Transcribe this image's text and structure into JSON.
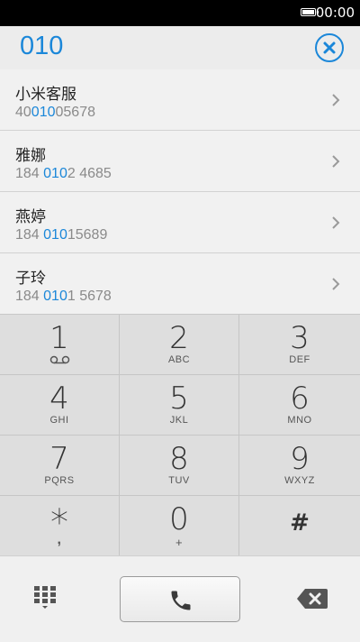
{
  "status_bar": {
    "time": "00:00",
    "battery_icon": "battery-icon"
  },
  "dialer": {
    "input_value": "010",
    "clear_icon": "close-circle-icon"
  },
  "contacts": [
    {
      "name": "小米客服",
      "number": [
        {
          "t": "40"
        },
        {
          "t": "010",
          "hl": true
        },
        {
          "t": "05678"
        }
      ]
    },
    {
      "name": "雅娜",
      "number": [
        {
          "t": "184 "
        },
        {
          "t": "010",
          "hl": true
        },
        {
          "t": "2 4685"
        }
      ]
    },
    {
      "name": "燕婷",
      "number": [
        {
          "t": "184 "
        },
        {
          "t": "010",
          "hl": true
        },
        {
          "t": "15689"
        }
      ]
    },
    {
      "name": "子玲",
      "number": [
        {
          "t": "184 "
        },
        {
          "t": "010",
          "hl": true
        },
        {
          "t": "1 5678"
        }
      ]
    }
  ],
  "keypad": [
    {
      "digit": "1",
      "letters": "",
      "icon": "voicemail-icon"
    },
    {
      "digit": "2",
      "letters": "ABC"
    },
    {
      "digit": "3",
      "letters": "DEF"
    },
    {
      "digit": "4",
      "letters": "GHI"
    },
    {
      "digit": "5",
      "letters": "JKL"
    },
    {
      "digit": "6",
      "letters": "MNO"
    },
    {
      "digit": "7",
      "letters": "PQRS"
    },
    {
      "digit": "8",
      "letters": "TUV"
    },
    {
      "digit": "9",
      "letters": "WXYZ"
    },
    {
      "digit": "*",
      "letters": ","
    },
    {
      "digit": "0",
      "letters": "+"
    },
    {
      "digit": "#",
      "letters": ""
    }
  ],
  "actions": {
    "keypad_toggle_icon": "dialpad-icon",
    "call_icon": "phone-icon",
    "backspace_icon": "backspace-icon"
  },
  "colors": {
    "accent": "#1b87d9"
  }
}
